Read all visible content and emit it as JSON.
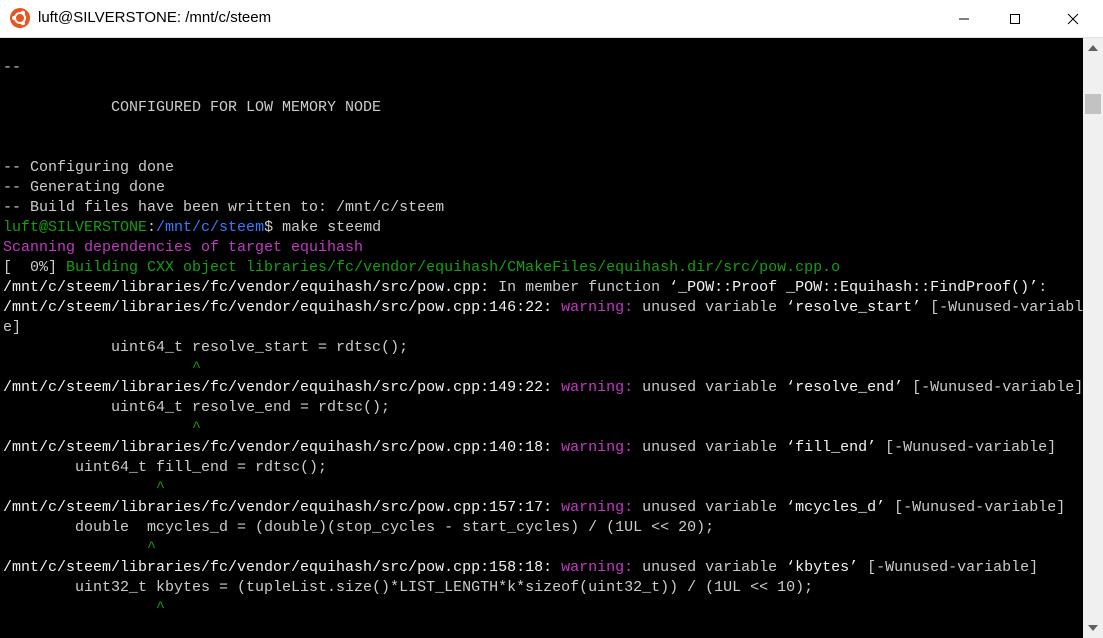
{
  "window": {
    "title": "luft@SILVERSTONE: /mnt/c/steem"
  },
  "colors": {
    "prompt_user": "#13a10e",
    "prompt_path": "#3b78ff",
    "warning": "#c239c2",
    "caret": "#13a10e",
    "text": "#cccccc",
    "background": "#000000"
  },
  "icons": {
    "app": "ubuntu-icon",
    "minimize": "minimize-icon",
    "maximize": "maximize-icon",
    "close": "close-icon"
  },
  "terminal": {
    "l01": "--",
    "l02": "            CONFIGURED FOR LOW MEMORY NODE",
    "l03": "-- Configuring done",
    "l04": "-- Generating done",
    "l05": "-- Build files have been written to: /mnt/c/steem",
    "prompt_user": "luft@SILVERSTONE",
    "prompt_sep": ":",
    "prompt_path": "/mnt/c/steem",
    "prompt_cmd": "$ make steemd",
    "l07": "Scanning dependencies of target equihash",
    "l08a": "[  0%] ",
    "l08b": "Building CXX object libraries/fc/vendor/equihash/CMakeFiles/equihash.dir/src/pow.cpp.o",
    "l09a": "/mnt/c/steem/libraries/fc/vendor/equihash/src/pow.cpp:",
    "l09b": " In member function ",
    "l09c": "‘_POW::Proof _POW::Equihash::FindProof()’",
    "l09d": ":",
    "w1_loc": "/mnt/c/steem/libraries/fc/vendor/equihash/src/pow.cpp:146:22:",
    "warning_label": " warning:",
    "w1_msg": " unused variable ",
    "w1_var": "‘resolve_start’",
    "w1_flag_a": " [-Wunused-variabl",
    "w1_flag_b": "e]",
    "w1_code": "            uint64_t resolve_start = rdtsc();",
    "w1_caret": "                     ^",
    "w2_loc": "/mnt/c/steem/libraries/fc/vendor/equihash/src/pow.cpp:149:22:",
    "w2_msg": " unused variable ",
    "w2_var": "‘resolve_end’",
    "w2_flag": " [-Wunused-variable]",
    "w2_code": "            uint64_t resolve_end = rdtsc();",
    "w2_caret": "                     ^",
    "w3_loc": "/mnt/c/steem/libraries/fc/vendor/equihash/src/pow.cpp:140:18:",
    "w3_msg": " unused variable ",
    "w3_var": "‘fill_end’",
    "w3_flag": " [-Wunused-variable]",
    "w3_code": "        uint64_t fill_end = rdtsc();",
    "w3_caret": "                 ^",
    "w4_loc": "/mnt/c/steem/libraries/fc/vendor/equihash/src/pow.cpp:157:17:",
    "w4_msg": " unused variable ",
    "w4_var": "‘mcycles_d’",
    "w4_flag": " [-Wunused-variable]",
    "w4_code": "        double  mcycles_d = (double)(stop_cycles - start_cycles) / (1UL << 20);",
    "w4_caret": "                ^",
    "w5_loc": "/mnt/c/steem/libraries/fc/vendor/equihash/src/pow.cpp:158:18:",
    "w5_msg": " unused variable ",
    "w5_var": "‘kbytes’",
    "w5_flag": " [-Wunused-variable]",
    "w5_code": "        uint32_t kbytes = (tupleList.size()*LIST_LENGTH*k*sizeof(uint32_t)) / (1UL << 10);",
    "w5_caret": "                 ^"
  }
}
